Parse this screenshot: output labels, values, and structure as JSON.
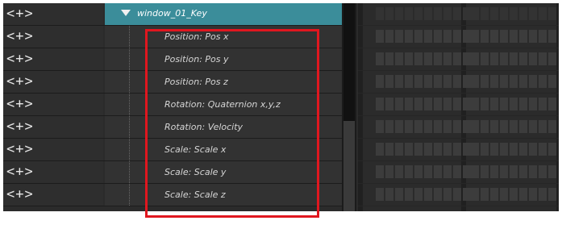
{
  "header_row": {
    "nav_label": "<+>",
    "node_name": "window_01_Key"
  },
  "channels": [
    {
      "nav_label": "<+>",
      "label": "Position: Pos x"
    },
    {
      "nav_label": "<+>",
      "label": "Position: Pos y"
    },
    {
      "nav_label": "<+>",
      "label": "Position: Pos z"
    },
    {
      "nav_label": "<+>",
      "label": "Rotation: Quaternion x,y,z"
    },
    {
      "nav_label": "<+>",
      "label": "Rotation: Velocity"
    },
    {
      "nav_label": "<+>",
      "label": "Scale: Scale x"
    },
    {
      "nav_label": "<+>",
      "label": "Scale: Scale y"
    },
    {
      "nav_label": "<+>",
      "label": "Scale: Scale z"
    }
  ],
  "colors": {
    "header_accent": "#3b8d9a",
    "highlight": "#e0171f",
    "panel_bg": "#2b2b2b"
  },
  "icons": {
    "expand": "triangle-down-icon"
  }
}
